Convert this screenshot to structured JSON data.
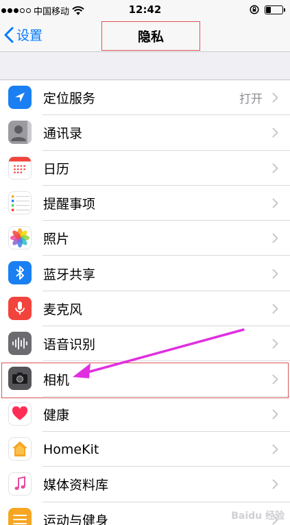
{
  "status_bar": {
    "carrier": "中国移动",
    "time": "12:42",
    "battery_level": 0.3
  },
  "nav": {
    "back_label": "设置",
    "title": "隐私"
  },
  "rows": [
    {
      "label": "定位服务",
      "value": "打开",
      "icon": "location-arrow-icon",
      "icon_bg": "#1a7ff2"
    },
    {
      "label": "通讯录",
      "value": "",
      "icon": "contacts-icon",
      "icon_bg": "#8e8e93"
    },
    {
      "label": "日历",
      "value": "",
      "icon": "calendar-icon",
      "icon_bg": "#ffffff"
    },
    {
      "label": "提醒事项",
      "value": "",
      "icon": "reminders-icon",
      "icon_bg": "#ffffff"
    },
    {
      "label": "照片",
      "value": "",
      "icon": "photos-icon",
      "icon_bg": "#ffffff"
    },
    {
      "label": "蓝牙共享",
      "value": "",
      "icon": "bluetooth-icon",
      "icon_bg": "#1a7ff2"
    },
    {
      "label": "麦克风",
      "value": "",
      "icon": "microphone-icon",
      "icon_bg": "#f2443c"
    },
    {
      "label": "语音识别",
      "value": "",
      "icon": "speech-recognition-icon",
      "icon_bg": "#6b6b70"
    },
    {
      "label": "相机",
      "value": "",
      "icon": "camera-icon",
      "icon_bg": "#555559"
    },
    {
      "label": "健康",
      "value": "",
      "icon": "health-heart-icon",
      "icon_bg": "#ffffff"
    },
    {
      "label": "HomeKit",
      "value": "",
      "icon": "homekit-house-icon",
      "icon_bg": "#ffffff"
    },
    {
      "label": "媒体资料库",
      "value": "",
      "icon": "music-note-icon",
      "icon_bg": "#ffffff"
    },
    {
      "label": "运动与健身",
      "value": "",
      "icon": "motion-fitness-icon",
      "icon_bg": "#f6a623"
    }
  ],
  "highlighted_row": "相机",
  "colors": {
    "accent": "#007aff",
    "annotation": "#e02fe0",
    "highlight_box": "#d9534f"
  },
  "watermark": "Baidu 经验"
}
